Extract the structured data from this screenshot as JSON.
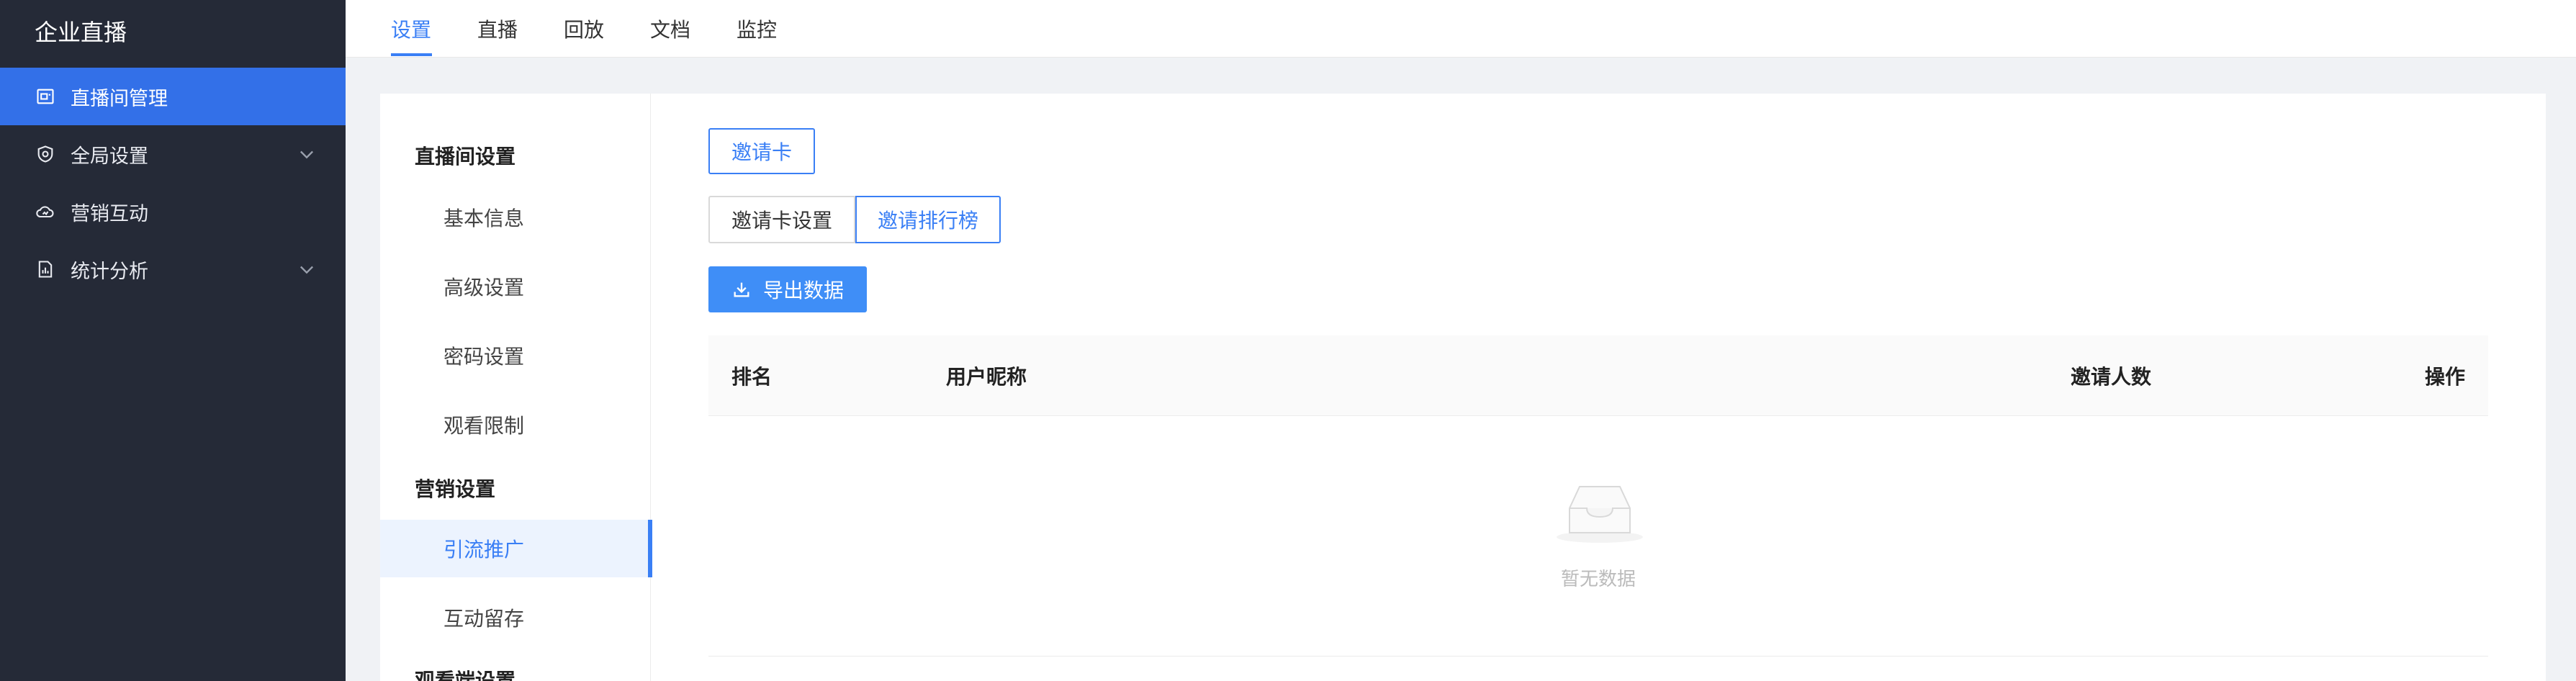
{
  "sidebar": {
    "brand": "企业直播",
    "items": [
      {
        "label": "直播间管理",
        "icon": "screen-icon",
        "active": true
      },
      {
        "label": "全局设置",
        "icon": "shield-icon",
        "expandable": true
      },
      {
        "label": "营销互动",
        "icon": "cloud-icon"
      },
      {
        "label": "统计分析",
        "icon": "report-icon",
        "expandable": true
      }
    ]
  },
  "tabs": [
    {
      "label": "设置",
      "active": true
    },
    {
      "label": "直播"
    },
    {
      "label": "回放"
    },
    {
      "label": "文档"
    },
    {
      "label": "监控"
    }
  ],
  "subnav": {
    "groups": [
      {
        "title": "直播间设置",
        "items": [
          "基本信息",
          "高级设置",
          "密码设置",
          "观看限制"
        ]
      },
      {
        "title": "营销设置",
        "items": [
          "引流推广",
          "互动留存"
        ]
      },
      {
        "title": "观看端设置",
        "items": []
      }
    ],
    "active_item": "引流推广"
  },
  "content": {
    "invite_card_button": "邀请卡",
    "segments": [
      "邀请卡设置",
      "邀请排行榜"
    ],
    "active_segment": "邀请排行榜",
    "export_button": "导出数据",
    "table": {
      "columns": [
        "排名",
        "用户昵称",
        "邀请人数",
        "操作"
      ],
      "rows": [],
      "empty_text": "暂无数据"
    }
  },
  "colors": {
    "accent": "#3a7ff5",
    "sidebar_bg": "#252a37",
    "sidebar_active": "#3370e8"
  }
}
